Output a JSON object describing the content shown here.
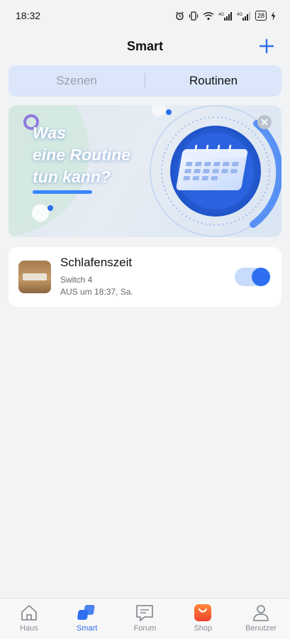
{
  "status_bar": {
    "time": "18:32",
    "battery": "28",
    "icons": [
      "alarm-icon",
      "vibrate-icon",
      "wifi-icon",
      "signal-4g-icon",
      "signal-4g-icon",
      "battery-icon",
      "charging-icon"
    ]
  },
  "header": {
    "title": "Smart",
    "add_icon": "plus-icon",
    "accent": "#2d6ff0"
  },
  "segments": {
    "scenes": "Szenen",
    "routines": "Routinen",
    "active": "Routinen"
  },
  "banner": {
    "line1": "Was",
    "line2": "eine Routine",
    "line3": "tun kann?",
    "close_icon": "close-icon"
  },
  "routines": [
    {
      "name": "Schlafenszeit",
      "device": "Switch 4",
      "schedule": "AUS um 18:37, Sa.",
      "enabled": true
    }
  ],
  "nav": {
    "items": [
      {
        "label": "Haus",
        "icon": "home-icon",
        "active": false
      },
      {
        "label": "Smart",
        "icon": "smart-icon",
        "active": true
      },
      {
        "label": "Forum",
        "icon": "forum-icon",
        "active": false
      },
      {
        "label": "Shop",
        "icon": "shop-bag-icon",
        "active": false
      },
      {
        "label": "Benutzer",
        "icon": "user-icon",
        "active": false
      }
    ]
  }
}
